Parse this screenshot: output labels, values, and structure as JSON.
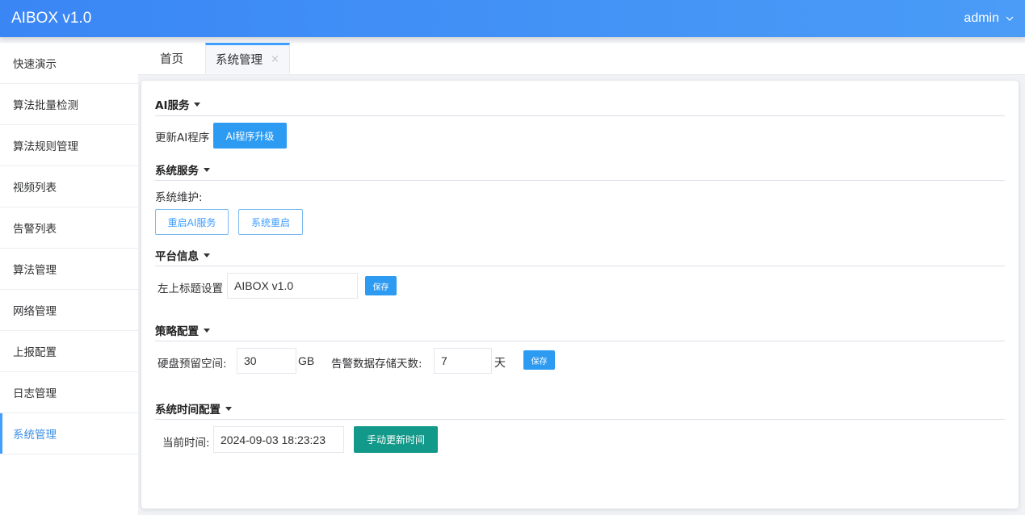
{
  "header": {
    "title": "AIBOX v1.0",
    "user": "admin"
  },
  "sidebar": {
    "items": [
      {
        "label": "快速演示"
      },
      {
        "label": "算法批量检测"
      },
      {
        "label": "算法规则管理"
      },
      {
        "label": "视频列表"
      },
      {
        "label": "告警列表"
      },
      {
        "label": "算法管理"
      },
      {
        "label": "网络管理"
      },
      {
        "label": "上报配置"
      },
      {
        "label": "日志管理"
      },
      {
        "label": "系统管理"
      }
    ],
    "active_index": 9
  },
  "tabs": {
    "home": "首页",
    "system": "系统管理",
    "close_glyph": "×"
  },
  "ai_service": {
    "title": "AI服务",
    "update_label": "更新AI程序",
    "upgrade_button": "AI程序升级"
  },
  "system_service": {
    "title": "系统服务",
    "maintenance_label": "系统维护:",
    "restart_ai_button": "重启AI服务",
    "reboot_button": "系统重启"
  },
  "platform_info": {
    "title": "平台信息",
    "title_setting_label": "左上标题设置",
    "title_value": "AIBOX v1.0",
    "save_button": "保存"
  },
  "policy": {
    "title": "策略配置",
    "disk_label": "硬盘预留空间:",
    "disk_value": "30",
    "disk_unit": "GB",
    "alarm_days_label": "告警数据存储天数:",
    "alarm_days_value": "7",
    "days_unit": "天",
    "save_button": "保存"
  },
  "time_config": {
    "title": "系统时间配置",
    "current_time_label": "当前时间:",
    "current_time_value": "2024-09-03 18:23:23",
    "update_button": "手动更新时间"
  },
  "colors": {
    "accent": "#409eff",
    "header_start": "#3a86f5",
    "teal": "#12998a"
  }
}
